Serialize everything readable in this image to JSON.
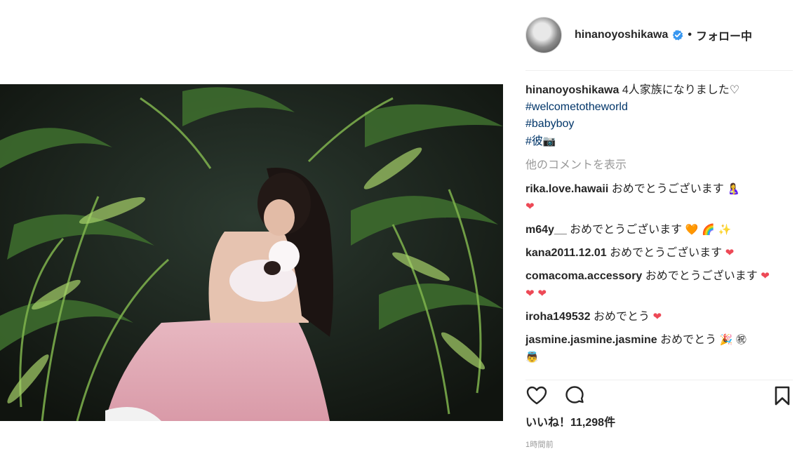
{
  "header": {
    "username": "hinanoyoshikawa",
    "separator": "•",
    "follow_label": "フォロー中"
  },
  "caption": {
    "username": "hinanoyoshikawa",
    "text": "4人家族になりました♡",
    "hashtags": [
      "#welcometotheworld",
      "#babyboy",
      "#彼"
    ],
    "camera_emoji": "📷"
  },
  "load_more_label": "他のコメントを表示",
  "comments": [
    {
      "username": "rika.love.hawaii",
      "text": "おめでとうございます",
      "emoji": "🤱",
      "emoji2": "❤"
    },
    {
      "username": "m64y__",
      "text": "おめでとうございます",
      "emoji": "🧡 🌈 ✨"
    },
    {
      "username": "kana2011.12.01",
      "text": "おめでとうございます",
      "emoji": "❤"
    },
    {
      "username": "comacoma.accessory",
      "text": "おめでとうございます",
      "emoji": "❤ ❤ ❤"
    },
    {
      "username": "iroha149532",
      "text": "おめでとう",
      "emoji": "❤"
    },
    {
      "username": "jasmine.jasmine.jasmine",
      "text": "おめでとう",
      "emoji": "🎉 ㊗",
      "emoji2": "👼"
    }
  ],
  "likes": {
    "label": "いいね！",
    "count": "11,298件"
  },
  "timestamp": "1時間前",
  "icons": {
    "like": "heart-outline-icon",
    "comment": "speech-bubble-icon",
    "save": "bookmark-icon",
    "verified": "verified-badge-icon"
  },
  "colors": {
    "verified": "#3897f0",
    "hashtag": "#003569",
    "muted": "#999999",
    "heart": "#ed4956"
  }
}
